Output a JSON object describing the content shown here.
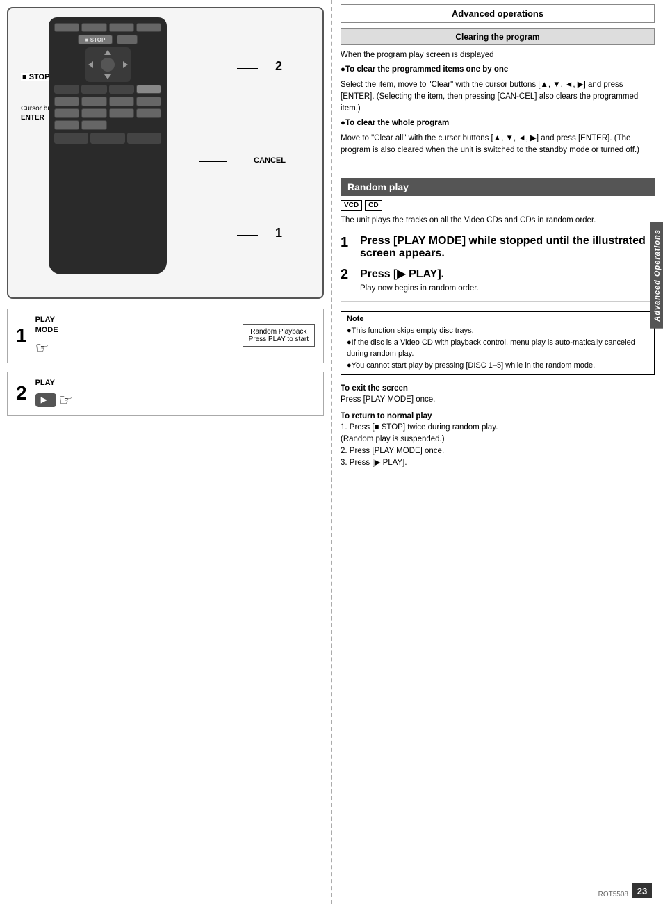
{
  "left": {
    "step1_label": "PLAY\nMODE",
    "step1_num": "1",
    "step2_label": "PLAY",
    "step2_num": "2",
    "screen_line1": "Random Playback",
    "screen_line2": "Press PLAY to start",
    "stop_label": "■ STOP",
    "cursor_label": "Cursor\nbuttons/",
    "enter_label": "ENTER",
    "cancel_label": "CANCEL",
    "label_2": "2",
    "label_1": "1"
  },
  "right": {
    "section_title": "Advanced operations",
    "sub_title": "Clearing the program",
    "clearing_intro": "When the program play screen is displayed",
    "bullet1_head": "●To clear the programmed items one by one",
    "bullet1_body": "Select the item, move to \"Clear\" with the cursor buttons [▲, ▼, ◄, ▶] and press [ENTER]. (Selecting the item, then pressing [CAN-CEL] also clears the programmed item.)",
    "bullet2_head": "●To clear the whole program",
    "bullet2_body": "Move to \"Clear all\" with the cursor buttons [▲, ▼, ◄, ▶] and press [ENTER]. (The program is also cleared when the unit is switched to the standby mode or turned off.)",
    "random_play_title": "Random play",
    "vcd_badge": "VCD",
    "cd_badge": "CD",
    "random_desc": "The unit plays the tracks on all the Video CDs and CDs in random order.",
    "step1_text": "Press [PLAY MODE] while stopped until the illustrated screen appears.",
    "step2_text": "Press [▶ PLAY].",
    "step2_sub": "Play now begins in random order.",
    "note_title": "Note",
    "note1": "●This function skips empty disc trays.",
    "note2": "●If the disc is a Video CD with playback control, menu play is auto-matically canceled during random play.",
    "note3": "●You cannot start play by pressing [DISC 1–5] while in the random mode.",
    "exit_heading": "To exit the screen",
    "exit_text": "Press [PLAY MODE] once.",
    "return_heading": "To return to normal play",
    "return_step1": "1.  Press [■ STOP] twice during random play.",
    "return_step1b": "    (Random play is suspended.)",
    "return_step2": "2.  Press [PLAY MODE] once.",
    "return_step3": "3.  Press [▶ PLAY].",
    "sidebar_label": "Advanced Operations",
    "page_num": "23",
    "rot_code": "ROT5508"
  }
}
